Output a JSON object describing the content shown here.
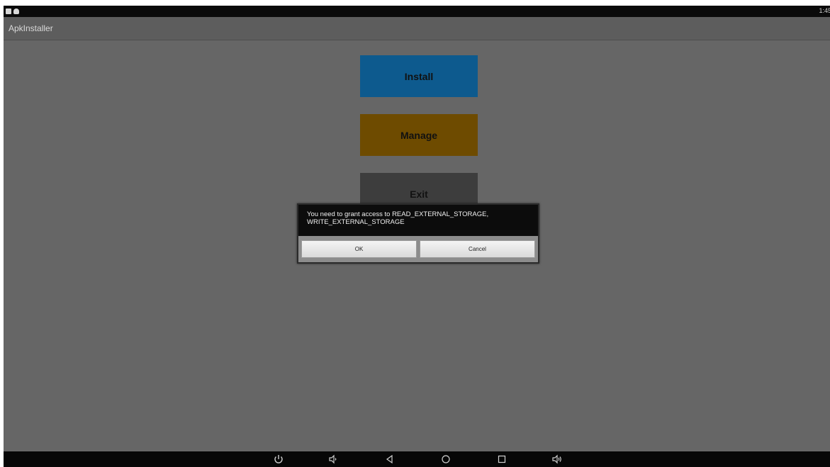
{
  "status_bar": {
    "time": "1:45",
    "icons": [
      "sd-card-icon",
      "android-icon",
      "signal-icon"
    ]
  },
  "action_bar": {
    "title": "ApkInstaller"
  },
  "menu": {
    "install_label": "Install",
    "manage_label": "Manage",
    "exit_label": "Exit",
    "colors": {
      "install": "#0d5a8e",
      "manage": "#6e4b00",
      "exit": "#3d3d3d"
    }
  },
  "dialog": {
    "message_line1": "You need to grant access to READ_EXTERNAL_STORAGE,",
    "message_line2": "WRITE_EXTERNAL_STORAGE",
    "ok_label": "OK",
    "cancel_label": "Cancel"
  },
  "nav_bar": {
    "icons": [
      "power-icon",
      "volume-down-icon",
      "back-icon",
      "home-icon",
      "recents-icon",
      "volume-up-icon"
    ]
  }
}
